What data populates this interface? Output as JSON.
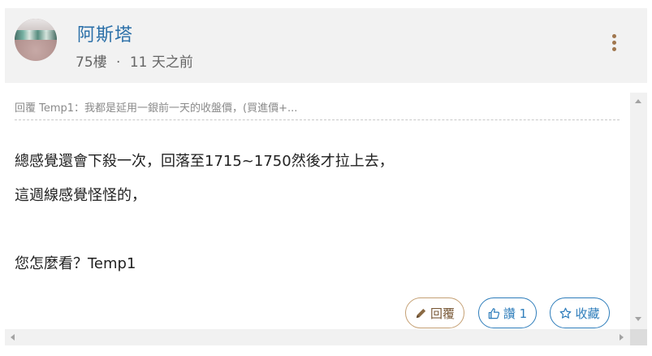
{
  "post": {
    "author": "阿斯塔",
    "floor": "75樓",
    "separator": "·",
    "time": "11 天之前"
  },
  "quote": {
    "text": "回覆 Temp1：我都是延用一銀前一天的收盤價，(買進價+..."
  },
  "content": {
    "lines": [
      "總感覺還會下殺一次，回落至1715~1750然後才拉上去，",
      "這週線感覺怪怪的，",
      "",
      "您怎麼看？Temp1"
    ]
  },
  "actions": {
    "reply_label": "回覆",
    "like_label": "讚 1",
    "favorite_label": "收藏"
  },
  "colors": {
    "author": "#2a6fa8",
    "reply_border": "#c5a074",
    "action_blue": "#2e7dbb",
    "kebab": "#a0774e"
  },
  "icons": {
    "menu": "kebab-vertical",
    "reply": "pencil",
    "like": "thumbs-up",
    "favorite": "star"
  }
}
